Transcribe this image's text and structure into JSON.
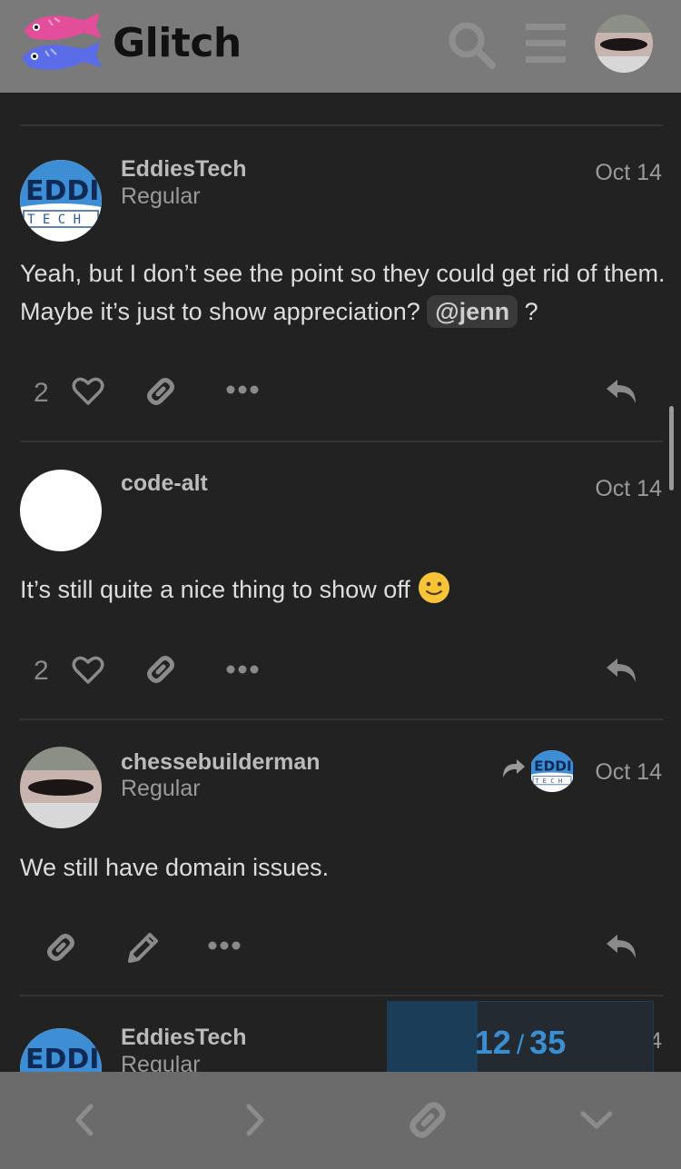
{
  "header": {
    "brand": "Glitch",
    "icons": [
      "glitch-logo-icon",
      "search-icon",
      "menu-icon",
      "user-avatar"
    ]
  },
  "posts": [
    {
      "username": "EddiesTech",
      "title": "Regular",
      "date": "Oct 14",
      "body_before": "Yeah, but I don’t see the point so they could get rid of them. Maybe it’s just to show appreciation? ",
      "mention": "@jenn",
      "body_after": " ?",
      "likes": "2"
    },
    {
      "username": "code-alt",
      "date": "Oct 14",
      "body": "It’s still quite a nice thing to show off",
      "emoji": "🙂",
      "likes": "2"
    },
    {
      "username": "chessebuilderman",
      "title": "Regular",
      "date": "Oct 14",
      "body": "We still have domain issues."
    },
    {
      "username": "EddiesTech",
      "title": "Regular",
      "date_partial": "4"
    }
  ],
  "progress": {
    "current": "12",
    "separator": "/",
    "total": "35",
    "fill_fraction": 0.34
  },
  "colors": {
    "header_bg": "#7a7a7a",
    "page_bg": "#222222",
    "accent": "#3b8fd1",
    "bottom_bar_bg": "#6b6b6b"
  }
}
